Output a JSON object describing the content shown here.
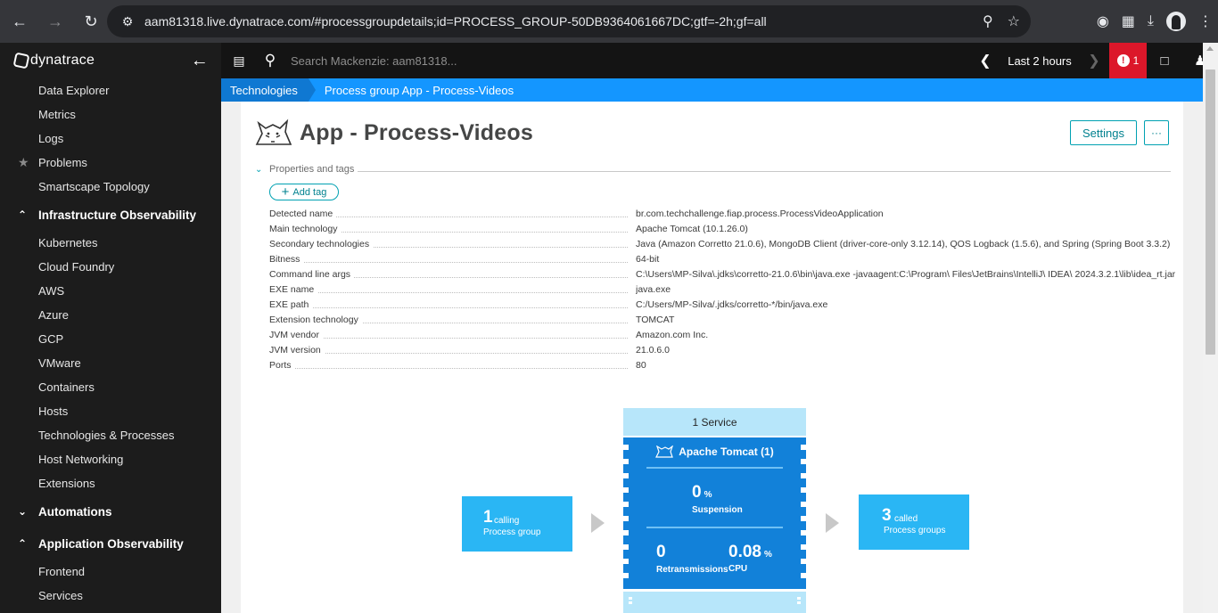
{
  "browser": {
    "url": "aam81318.live.dynatrace.com/#processgroupdetails;id=PROCESS_GROUP-50DB9364061667DC;gtf=-2h;gf=all"
  },
  "sidebar": {
    "logo_text": "dynatrace",
    "items": [
      {
        "label": "Data Explorer"
      },
      {
        "label": "Metrics"
      },
      {
        "label": "Logs"
      },
      {
        "label": "Problems"
      },
      {
        "label": "Smartscape Topology"
      }
    ],
    "infra_section": "Infrastructure Observability",
    "infra_items": [
      {
        "label": "Kubernetes"
      },
      {
        "label": "Cloud Foundry"
      },
      {
        "label": "AWS"
      },
      {
        "label": "Azure"
      },
      {
        "label": "GCP"
      },
      {
        "label": "VMware"
      },
      {
        "label": "Containers"
      },
      {
        "label": "Hosts"
      },
      {
        "label": "Technologies & Processes"
      },
      {
        "label": "Host Networking"
      },
      {
        "label": "Extensions"
      }
    ],
    "automations_section": "Automations",
    "app_section": "Application Observability",
    "app_items": [
      {
        "label": "Frontend"
      },
      {
        "label": "Services"
      }
    ]
  },
  "topbar": {
    "search_placeholder": "Search Mackenzie: aam81318...",
    "timeframe": "Last 2 hours",
    "problem_count": "1"
  },
  "breadcrumb": {
    "first": "Technologies",
    "current": "Process group App - Process-Videos"
  },
  "page": {
    "title": "App - Process-Videos",
    "settings_label": "Settings",
    "more_label": "···",
    "properties_label": "Properties and tags",
    "add_tag_label": "Add tag"
  },
  "properties": [
    {
      "key": "Detected name",
      "value": "br.com.techchallenge.fiap.process.ProcessVideoApplication"
    },
    {
      "key": "Main technology",
      "value": "Apache Tomcat (10.1.26.0)"
    },
    {
      "key": "Secondary technologies",
      "value": "Java (Amazon Corretto 21.0.6), MongoDB Client (driver-core-only 3.12.14), QOS Logback (1.5.6), and Spring (Spring Boot 3.3.2)"
    },
    {
      "key": "Bitness",
      "value": "64-bit"
    },
    {
      "key": "Command line args",
      "value": "C:\\Users\\MP-Silva\\.jdks\\corretto-21.0.6\\bin\\java.exe -javaagent:C:\\Program\\ Files\\JetBrains\\IntelliJ\\ IDEA\\ 2024.3.2.1\\lib\\idea_rt.jar"
    },
    {
      "key": "EXE name",
      "value": "java.exe"
    },
    {
      "key": "EXE path",
      "value": "C:/Users/MP-Silva/.jdks/corretto-*/bin/java.exe"
    },
    {
      "key": "Extension technology",
      "value": "TOMCAT"
    },
    {
      "key": "JVM vendor",
      "value": "Amazon.com Inc."
    },
    {
      "key": "JVM version",
      "value": "21.0.6.0"
    },
    {
      "key": "Ports",
      "value": "80"
    }
  ],
  "topology": {
    "calling_count": "1",
    "calling_label": "calling",
    "calling_sub": "Process group",
    "services_header": "1 Service",
    "process_group_title": "Apache Tomcat (1)",
    "suspension_value": "0",
    "suspension_unit": "%",
    "suspension_label": "Suspension",
    "retransmissions_value": "0",
    "retransmissions_label": "Retransmissions",
    "cpu_value": "0.08",
    "cpu_unit": "%",
    "cpu_label": "CPU",
    "called_count": "3",
    "called_label": "called",
    "called_sub": "Process groups"
  },
  "colors": {
    "accent": "#1496ff",
    "teal": "#00a1b2",
    "alert": "#dc172a",
    "process_group_blue": "#1281d9",
    "light_blue": "#2ab6f4"
  },
  "icons": [
    "back-icon",
    "forward-icon",
    "reload-icon",
    "site-info-icon",
    "zoom-icon",
    "star-icon",
    "incognito-icon",
    "extensions-icon",
    "download-icon",
    "profile-icon",
    "menu-icon",
    "collapse-arrow-icon",
    "monitor-icon",
    "search-icon",
    "problem-alert-icon",
    "chat-icon",
    "user-icon",
    "tomcat-icon",
    "chevron-down-icon",
    "plus-icon"
  ]
}
